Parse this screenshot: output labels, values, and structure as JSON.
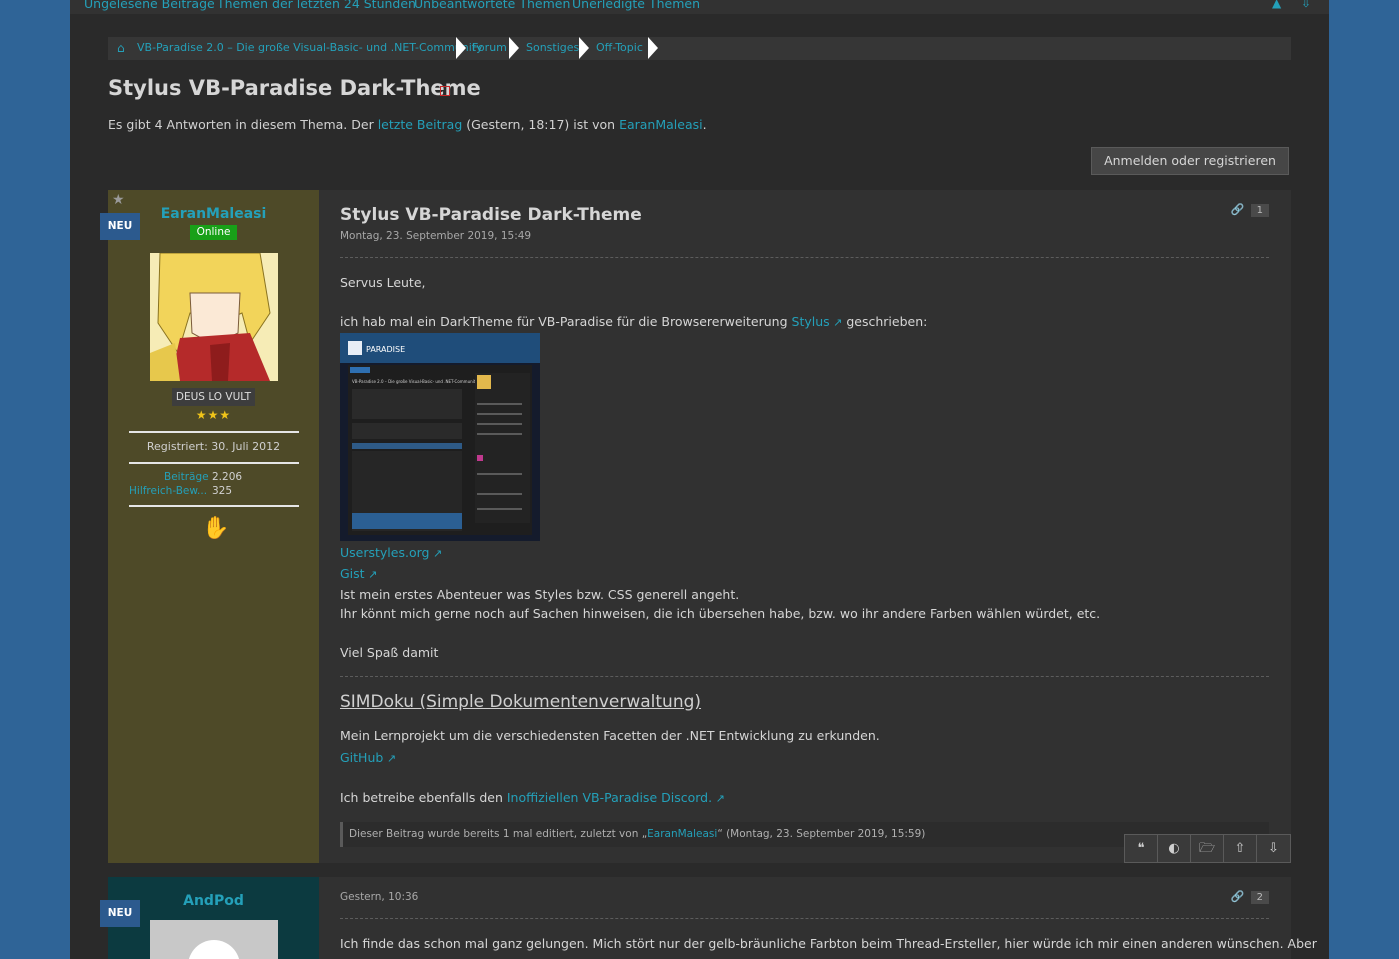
{
  "topnav": {
    "items": [
      "Ungelesene Beiträge",
      "Themen der letzten 24 Stunden",
      "Unbeantwortete Themen",
      "Unerledigte Themen"
    ],
    "icons": [
      "sitemap-icon",
      "chevron-down-icon"
    ]
  },
  "breadcrumb": {
    "home_icon": "home-icon",
    "items": [
      "VB-Paradise 2.0 – Die große Visual-Basic- und .NET-Community",
      "Forum",
      "Sonstiges",
      "Off-Topic"
    ]
  },
  "thread": {
    "title": "Stylus VB-Paradise Dark-Theme",
    "summary_pre": "Es gibt 4 Antworten in diesem Thema. Der ",
    "summary_link": "letzte Beitrag",
    "summary_mid": " (Gestern, 18:17) ist von ",
    "summary_user": "EaranMaleasi",
    "summary_end": ".",
    "login_button": "Anmelden oder registrieren"
  },
  "post1": {
    "badge": "NEU",
    "username": "EaranMaleasi",
    "online": "Online",
    "rank": "DEUS LO VULT",
    "registered": "Registriert: 30. Juli 2012",
    "stats": [
      {
        "label": "Beiträge",
        "value": "2.206"
      },
      {
        "label": "Hilfreich-Bew...",
        "value": "325"
      }
    ],
    "title": "Stylus VB-Paradise Dark-Theme",
    "date": "Montag, 23. September 2019, 15:49",
    "post_number": "1",
    "greeting": "Servus Leute,",
    "line1_pre": "ich hab mal ein DarkTheme für VB-Paradise für die Browsererweiterung ",
    "line1_link": "Stylus",
    "line1_post": " geschrieben:",
    "link_userstyles": "Userstyles.org",
    "link_gist": "Gist",
    "line2": "Ist mein erstes Abenteuer was Styles bzw. CSS generell angeht.",
    "line3": "Ihr könnt mich gerne noch auf Sachen hinweisen, die ich übersehen habe, bzw. wo ihr andere Farben wählen würdet, etc.",
    "line4": "Viel Spaß damit",
    "sig_title": "SIMDoku (Simple Dokumentenverwaltung)",
    "sig_line1": "Mein Lernprojekt um die verschiedensten Facetten der .NET Entwicklung zu erkunden.",
    "sig_github": "GitHub",
    "sig_line2_pre": "Ich betreibe ebenfalls den ",
    "sig_line2_link": "Inoffiziellen VB-Paradise Discord.",
    "edited_pre": "Dieser Beitrag wurde bereits 1 mal editiert, zuletzt von „",
    "edited_user": "EaranMaleasi",
    "edited_post": "“ (Montag, 23. September 2019, 15:59)",
    "actions": [
      "quote-icon",
      "multiquote-icon",
      "bookmark-icon",
      "arrow-up-icon",
      "arrow-down-icon"
    ],
    "screenshot_app": {
      "logo": "PARADISE",
      "heading": "VB-Paradise 2.0 – Die große Visual-Basic- und .NET-Community"
    }
  },
  "post2": {
    "badge": "NEU",
    "username": "AndPod",
    "date": "Gestern, 10:36",
    "post_number": "2",
    "text": "Ich finde das schon mal ganz gelungen. Mich stört nur der gelb-bräunliche Farbton beim Thread-Ersteller, hier würde ich mir einen anderen wünschen. Aber"
  },
  "colors": {
    "accent": "#24a0b9",
    "page_bg": "#2f6497",
    "panel_bg": "#2a2a2a",
    "op_sidebar": "#4e4a28",
    "user_sidebar": "#0c3a40"
  }
}
